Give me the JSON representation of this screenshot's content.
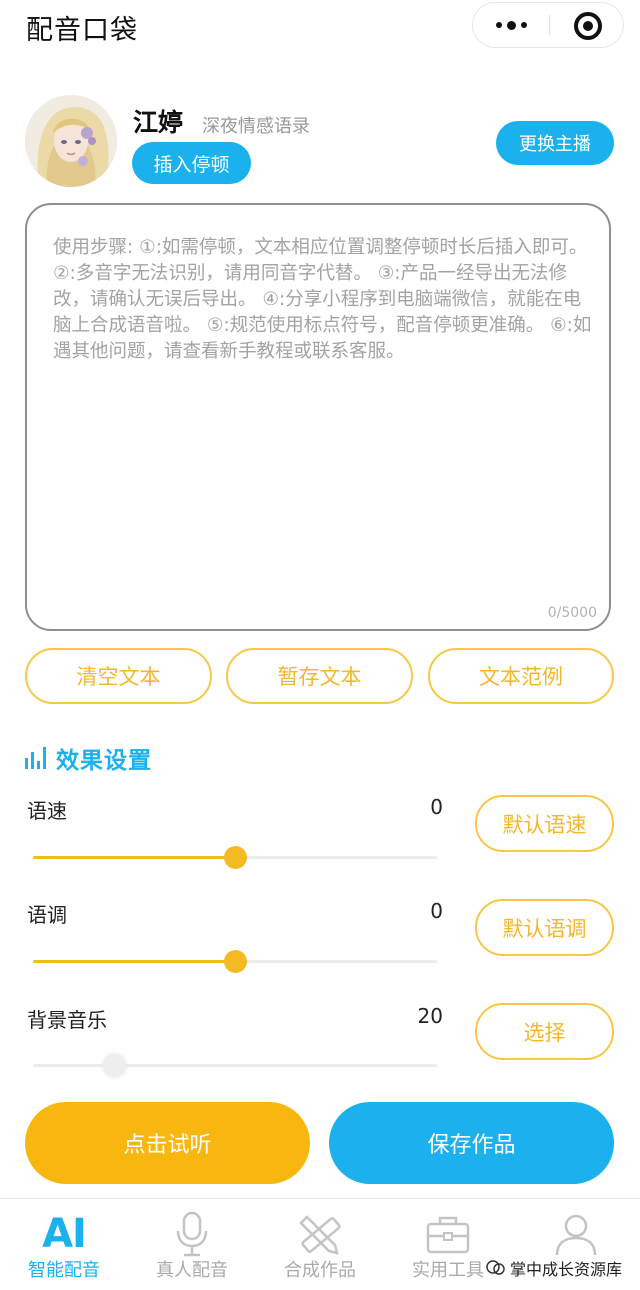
{
  "app": {
    "title": "配音口袋"
  },
  "capsule": {
    "more_icon": "more-dots-icon",
    "close_icon": "mini-program-close-icon"
  },
  "anchor": {
    "name": "江婷",
    "description": "深夜情感语录",
    "insert_pause_label": "插入停顿",
    "change_anchor_label": "更换主播"
  },
  "editor": {
    "instructions": "使用步骤: ①:如需停顿，文本相应位置调整停顿时长后插入即可。 ②:多音字无法识别，请用同音字代替。 ③:产品一经导出无法修改，请确认无误后导出。 ④:分享小程序到电脑端微信，就能在电脑上合成语音啦。 ⑤:规范使用标点符号，配音停顿更准确。 ⑥:如遇其他问题，请查看新手教程或联系客服。",
    "char_count": "0/5000"
  },
  "text_actions": {
    "clear_label": "清空文本",
    "save_draft_label": "暂存文本",
    "examples_label": "文本范例"
  },
  "effects": {
    "section_title": "效果设置",
    "speed": {
      "label": "语速",
      "value": "0",
      "level_fraction": 0.5,
      "reset_label": "默认语速"
    },
    "pitch": {
      "label": "语调",
      "value": "0",
      "level_fraction": 0.5,
      "reset_label": "默认语调"
    },
    "bgm": {
      "label": "背景音乐",
      "value": "20",
      "level_fraction": 0.2,
      "choose_label": "选择"
    }
  },
  "actions": {
    "listen_label": "点击试听",
    "save_work_label": "保存作品"
  },
  "tabbar": {
    "items": [
      {
        "icon": "ai-icon",
        "glyph": "AI",
        "label": "智能配音",
        "active": true
      },
      {
        "icon": "microphone-icon",
        "label": "真人配音",
        "active": false
      },
      {
        "icon": "pencil-ruler-icon",
        "label": "合成作品",
        "active": false
      },
      {
        "icon": "toolbox-icon",
        "label": "实用工具",
        "active": false
      },
      {
        "icon": "user-icon",
        "label": "",
        "active": false
      }
    ]
  },
  "watermark": {
    "text": "掌中成长资源库"
  },
  "colors": {
    "primary_blue": "#1ab1ec",
    "accent_yellow": "#f5b921",
    "outline_yellow": "#f6c845",
    "muted_text": "#a3a3a3"
  }
}
